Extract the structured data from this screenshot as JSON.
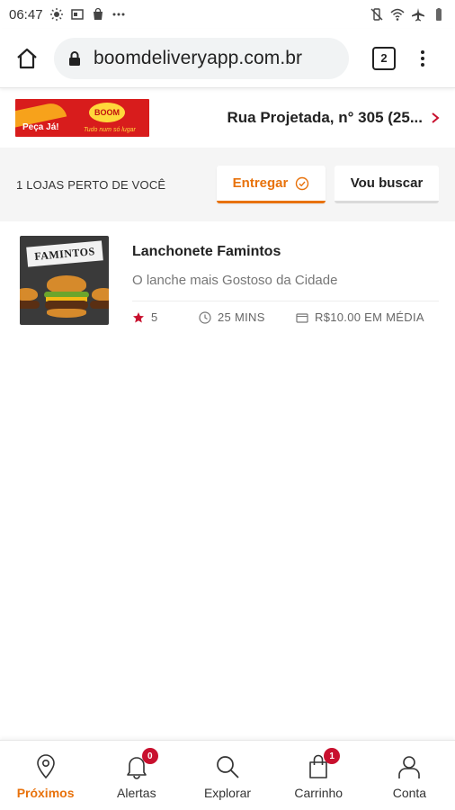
{
  "status_bar": {
    "time": "06:47",
    "left_icons": [
      "brightness-icon",
      "screen-icon",
      "bag-icon",
      "more-dots-icon"
    ],
    "right_icons": [
      "vibrate-mute-icon",
      "wifi-icon",
      "airplane-icon",
      "battery-icon"
    ]
  },
  "browser": {
    "url": "boomdeliveryapp.com.br",
    "tab_count": "2"
  },
  "header": {
    "logo": {
      "left_text": "Peça Já!",
      "brand": "BOOM",
      "tagline": "Tudo num só lugar"
    },
    "address": "Rua Projetada, n° 305 (25..."
  },
  "filter": {
    "store_count_label": "1 LOJAS PERTO DE VOCÊ",
    "deliver_label": "Entregar",
    "pickup_label": "Vou buscar"
  },
  "stores": [
    {
      "name": "Lanchonete Famintos",
      "thumbnail_text": "FAMINTOS",
      "description": "O lanche mais Gostoso da Cidade",
      "rating": "5",
      "time": "25 MINS",
      "avg_price": "R$10.00 EM MÉDIA"
    }
  ],
  "nav": {
    "items": [
      {
        "label": "Próximos",
        "icon": "location-pin-icon",
        "active": true
      },
      {
        "label": "Alertas",
        "icon": "bell-icon",
        "badge": "0"
      },
      {
        "label": "Explorar",
        "icon": "search-icon"
      },
      {
        "label": "Carrinho",
        "icon": "shopping-bag-icon",
        "badge": "1"
      },
      {
        "label": "Conta",
        "icon": "user-icon"
      }
    ]
  },
  "colors": {
    "accent": "#e8720c",
    "badge": "#c8102e",
    "rating_star": "#c8102e"
  }
}
